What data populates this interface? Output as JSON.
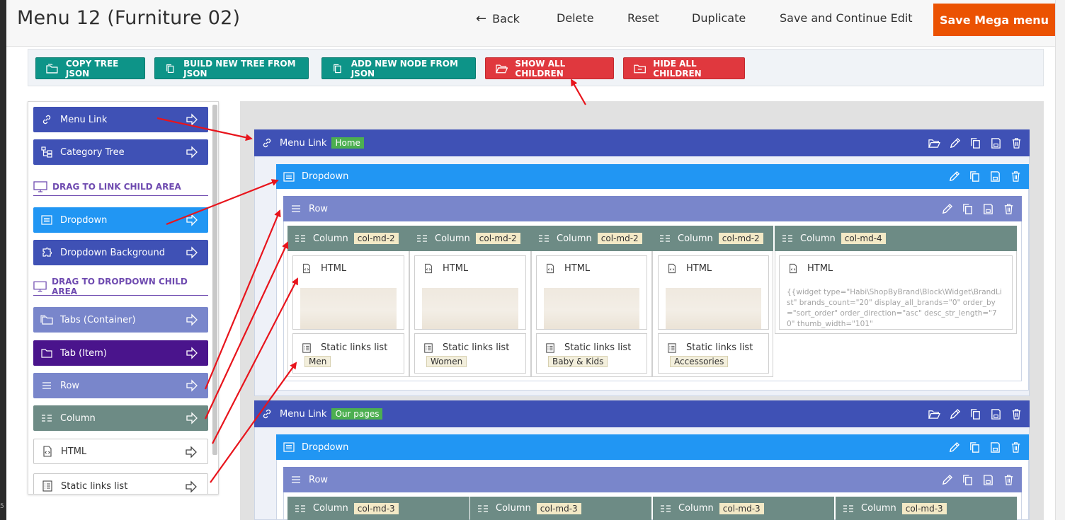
{
  "header": {
    "title": "Menu 12 (Furniture 02)",
    "back_label": "Back",
    "delete_label": "Delete",
    "reset_label": "Reset",
    "duplicate_label": "Duplicate",
    "save_continue_label": "Save and Continue Edit",
    "save_label": "Save Mega menu"
  },
  "toolbar": {
    "copy_tree": "COPY TREE JSON",
    "build_tree": "BUILD NEW TREE FROM JSON",
    "add_node": "ADD NEW NODE FROM JSON",
    "show_children": "SHOW ALL CHILDREN",
    "hide_children": "HIDE ALL CHILDREN"
  },
  "palette": {
    "menu_link": "Menu Link",
    "category_tree": "Category Tree",
    "heading_link": "DRAG TO LINK CHILD AREA",
    "dropdown": "Dropdown",
    "dropdown_bg": "Dropdown Background",
    "heading_dropdown": "DRAG TO DROPDOWN CHILD AREA",
    "tabs_container": "Tabs (Container)",
    "tab_item": "Tab (Item)",
    "row": "Row",
    "column": "Column",
    "html": "HTML",
    "static_links": "Static links list"
  },
  "tree": {
    "menu_link_1": {
      "label": "Menu Link",
      "tag": "Home"
    },
    "dropdown_1": "Dropdown",
    "row_1": "Row",
    "columns_1": [
      {
        "label": "Column",
        "tag": "col-md-2",
        "html": "HTML",
        "links": "Static links list",
        "links_tag": "Men"
      },
      {
        "label": "Column",
        "tag": "col-md-2",
        "html": "HTML",
        "links": "Static links list",
        "links_tag": "Women"
      },
      {
        "label": "Column",
        "tag": "col-md-2",
        "html": "HTML",
        "links": "Static links list",
        "links_tag": "Baby & Kids"
      },
      {
        "label": "Column",
        "tag": "col-md-2",
        "html": "HTML",
        "links": "Static links list",
        "links_tag": "Accessories"
      },
      {
        "label": "Column",
        "tag": "col-md-4",
        "html": "HTML",
        "code": "{{widget type=\"Habi\\ShopByBrand\\Block\\Widget\\BrandList\" brands_count=\"20\" display_all_brands=\"0\" order_by=\"sort_order\" order_direction=\"asc\" desc_str_length=\"70\" thumb_width=\"101\""
      }
    ],
    "menu_link_2": {
      "label": "Menu Link",
      "tag": "Our pages"
    },
    "dropdown_2": "Dropdown",
    "row_2": "Row",
    "columns_2": [
      {
        "label": "Column",
        "tag": "col-md-3"
      },
      {
        "label": "Column",
        "tag": "col-md-3"
      },
      {
        "label": "Column",
        "tag": "col-md-3"
      },
      {
        "label": "Column",
        "tag": "col-md-3"
      }
    ]
  },
  "colors": {
    "menu_link": "#3f51b5",
    "dropdown": "#2196f3",
    "row": "#7986cb",
    "column": "#6d8b85",
    "tab_item": "#4a148c",
    "accent_orange": "#eb5202",
    "teal": "#0d9488",
    "red": "#e0383e"
  }
}
